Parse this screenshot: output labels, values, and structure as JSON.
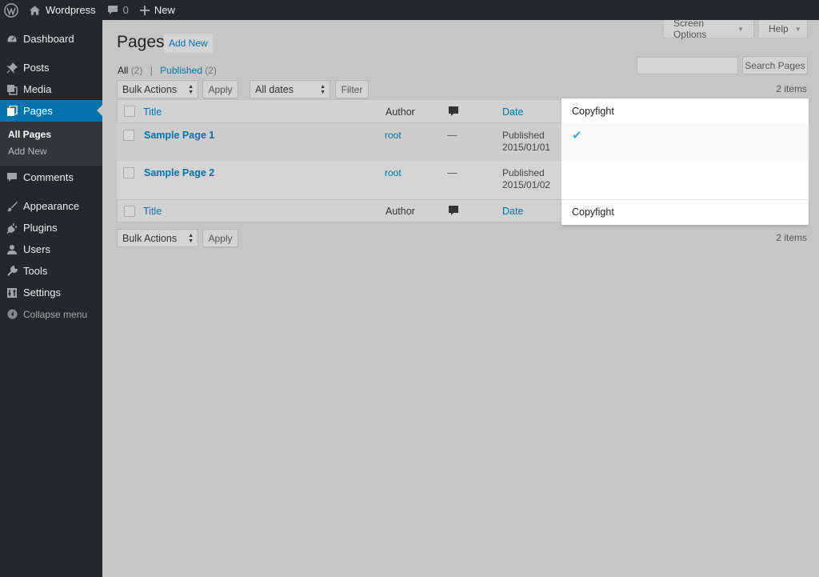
{
  "adminbar": {
    "site_name": "Wordpress",
    "comments_count": "0",
    "new_label": "New"
  },
  "sidebar": {
    "items": [
      {
        "label": "Dashboard",
        "icon": "dashboard-icon"
      },
      {
        "label": "Posts",
        "icon": "pin-icon"
      },
      {
        "label": "Media",
        "icon": "media-icon"
      },
      {
        "label": "Pages",
        "icon": "pages-icon",
        "current": true
      },
      {
        "label": "Comments",
        "icon": "comments-icon"
      },
      {
        "label": "Appearance",
        "icon": "brush-icon"
      },
      {
        "label": "Plugins",
        "icon": "plugin-icon"
      },
      {
        "label": "Users",
        "icon": "user-icon"
      },
      {
        "label": "Tools",
        "icon": "wrench-icon"
      },
      {
        "label": "Settings",
        "icon": "settings-icon"
      }
    ],
    "submenu": [
      "All Pages",
      "Add New"
    ],
    "collapse_label": "Collapse menu"
  },
  "header": {
    "screen_options": "Screen Options",
    "help": "Help",
    "title": "Pages",
    "add_new": "Add New"
  },
  "filters": {
    "all_label": "All",
    "all_count": "(2)",
    "separator": "|",
    "published_label": "Published",
    "published_count": "(2)"
  },
  "search": {
    "button": "Search Pages",
    "value": ""
  },
  "tablenav_top": {
    "bulk_actions": "Bulk Actions",
    "apply": "Apply",
    "dates": "All dates",
    "filter": "Filter",
    "items": "2 items"
  },
  "tablenav_bottom": {
    "bulk_actions": "Bulk Actions",
    "apply": "Apply",
    "items": "2 items"
  },
  "table": {
    "columns": {
      "title": "Title",
      "author": "Author",
      "date": "Date",
      "copyfight": "Copyfight"
    },
    "rows": [
      {
        "title": "Sample Page 1",
        "author": "root",
        "comments": "—",
        "status": "Published",
        "date": "2015/01/01",
        "copyfight": "✔"
      },
      {
        "title": "Sample Page 2",
        "author": "root",
        "comments": "—",
        "status": "Published",
        "date": "2015/01/02",
        "copyfight": ""
      }
    ]
  },
  "colors": {
    "accent": "#0073aa",
    "adminbar": "#23282d",
    "overlay": "#c6c6c6",
    "check": "#4ea4d4"
  }
}
